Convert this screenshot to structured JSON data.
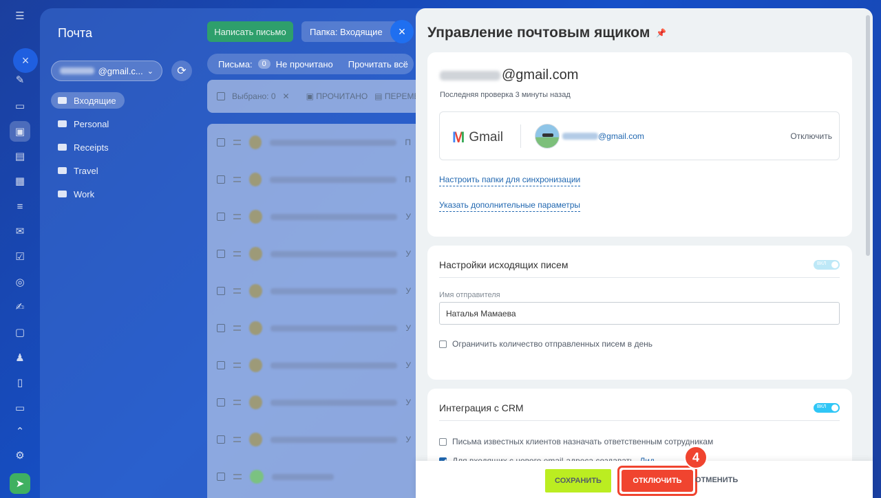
{
  "mail": {
    "title": "Почта",
    "account_suffix": "@gmail.c...",
    "folders": [
      {
        "label": "Входящие",
        "active": true
      },
      {
        "label": "Personal"
      },
      {
        "label": "Receipts"
      },
      {
        "label": "Travel"
      },
      {
        "label": "Work"
      }
    ],
    "compose_label": "Написать письмо",
    "folder_chip": "Папка: Входящие",
    "filter_label": "Письма:",
    "unread_count": "0",
    "unread_label": "Не прочитано",
    "read_all_label": "Прочитать всё",
    "selected_label": "Выбрано: 0",
    "mark_read_label": "ПРОЧИТАНО",
    "move_label": "ПЕРЕМЕ",
    "row_tails": [
      "П",
      "П",
      "У",
      "У",
      "У",
      "У",
      "У",
      "У",
      "У",
      ""
    ]
  },
  "panel": {
    "title": "Управление почтовым ящиком",
    "email_domain": "@gmail.com",
    "last_check": "Последняя проверка 3 минуты назад",
    "gmail_label": "Gmail",
    "account_email_domain": "@gmail.com",
    "disconnect_link": "Отключить",
    "link_folders": "Настроить папки для синхронизации",
    "link_params": "Указать дополнительные параметры",
    "outgoing": {
      "title": "Настройки исходящих писем",
      "sender_label": "Имя отправителя",
      "sender_value": "Наталья Мамаева",
      "limit_label": "Ограничить количество отправленных писем в день"
    },
    "crm": {
      "title": "Интеграция с CRM",
      "option1": "Письма известных клиентов назначать ответственным сотрудникам",
      "option2": "Для входящих с нового email-адреса создавать",
      "option2_link": "Лид"
    },
    "toggle_text": "ВКЛ"
  },
  "footer": {
    "save_label": "СОХРАНИТЬ",
    "disconnect_label": "ОТКЛЮЧИТЬ",
    "cancel_label": "ОТМЕНИТЬ",
    "step": "4"
  },
  "colors": {
    "accent_red": "#f0442f",
    "save_green": "#bbed21",
    "link_blue": "#2067b0",
    "compose_green": "#2e9f6c"
  }
}
